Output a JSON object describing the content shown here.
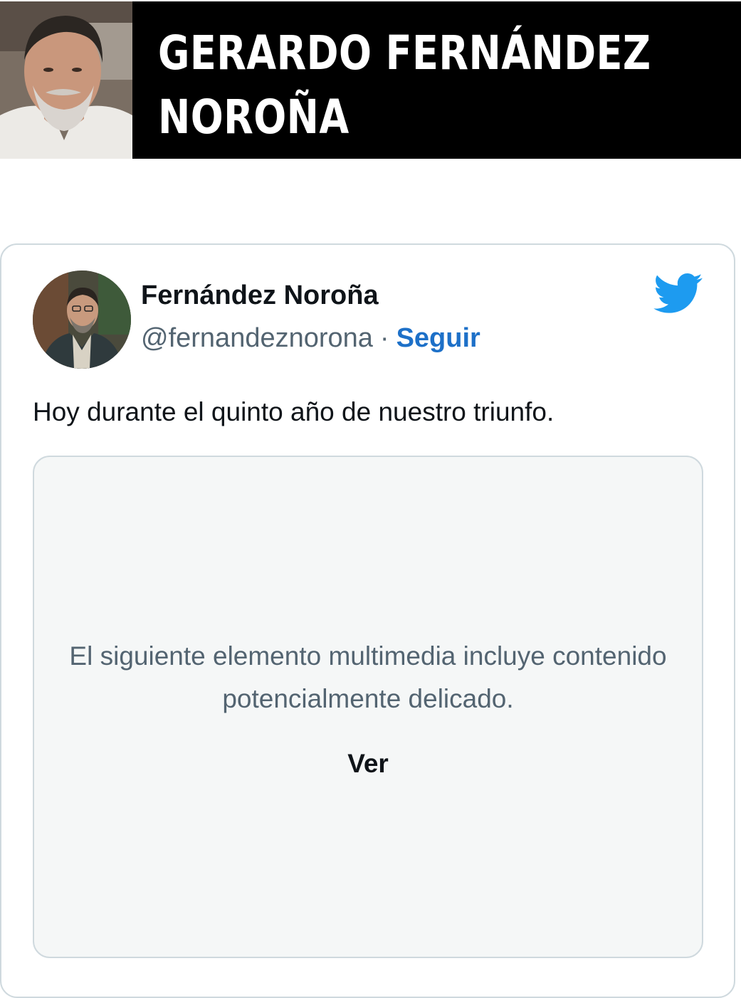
{
  "banner": {
    "title_line1": "GERARDO FERNÁNDEZ",
    "title_line2": "NOROÑA",
    "photo_icon": "person-portrait"
  },
  "tweet": {
    "display_name": "Fernández Noroña",
    "handle": "@fernandeznorona",
    "separator": "·",
    "follow_label": "Seguir",
    "text": "Hoy durante el quinto año de nuestro triunfo.",
    "media_warning": "El siguiente elemento multimedia incluye contenido potencialmente delicado.",
    "view_label": "Ver",
    "logo_icon": "twitter-bird",
    "avatar_icon": "person-portrait"
  },
  "colors": {
    "banner_bg": "#000000",
    "link_blue": "#1d70c8",
    "twitter_blue": "#1d9bf0",
    "secondary_text": "#536471",
    "border": "#cfd9de",
    "media_bg": "#f5f7f7"
  }
}
